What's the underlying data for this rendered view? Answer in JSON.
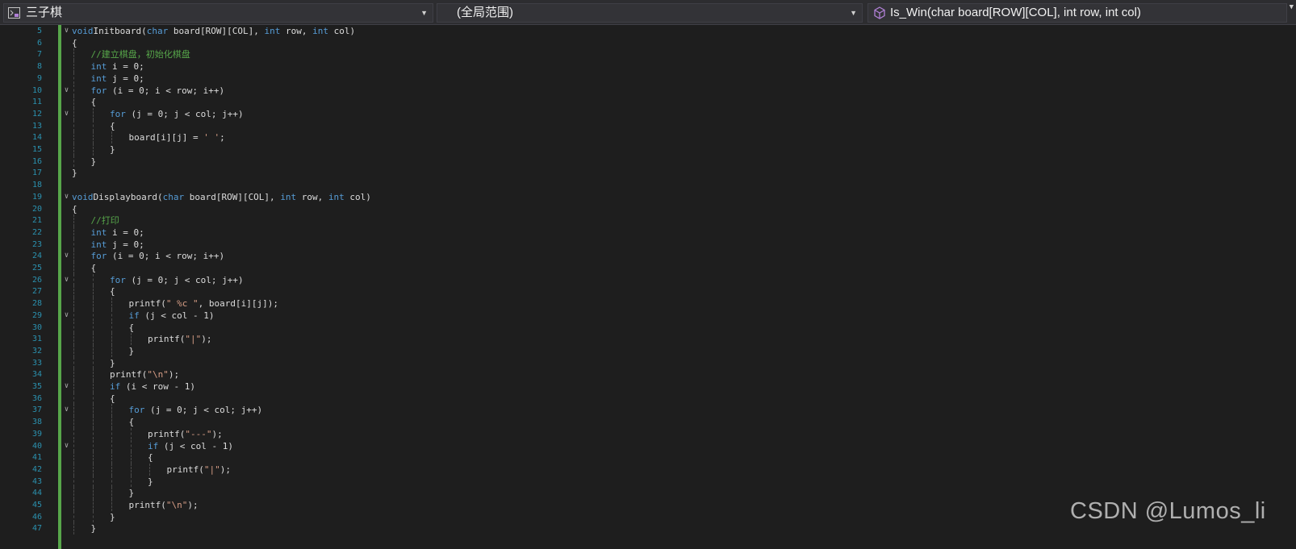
{
  "navbar": {
    "project": "三子棋",
    "scope": "(全局范围)",
    "member": "Is_Win(char board[ROW][COL], int row, int col)"
  },
  "lines": [
    {
      "n": "5",
      "fold": "v",
      "indent": 0,
      "tokens": [
        [
          "kw",
          "void"
        ],
        [
          "",
          "Initboard("
        ],
        [
          "kw",
          "char"
        ],
        [
          "",
          " board[ROW][COL], "
        ],
        [
          "kw",
          "int"
        ],
        [
          "",
          " row, "
        ],
        [
          "kw",
          "int"
        ],
        [
          "",
          " col)"
        ]
      ]
    },
    {
      "n": "6",
      "fold": "",
      "indent": 0,
      "tokens": [
        [
          "",
          "{"
        ]
      ]
    },
    {
      "n": "7",
      "fold": "",
      "indent": 1,
      "tokens": [
        [
          "cm",
          "//建立棋盘，初始化棋盘"
        ]
      ]
    },
    {
      "n": "8",
      "fold": "",
      "indent": 1,
      "tokens": [
        [
          "kw",
          "int"
        ],
        [
          "",
          " i = 0;"
        ]
      ]
    },
    {
      "n": "9",
      "fold": "",
      "indent": 1,
      "tokens": [
        [
          "kw",
          "int"
        ],
        [
          "",
          " j = 0;"
        ]
      ]
    },
    {
      "n": "10",
      "fold": "v",
      "indent": 1,
      "tokens": [
        [
          "kw",
          "for"
        ],
        [
          "",
          " (i = 0; i < row; i++)"
        ]
      ]
    },
    {
      "n": "11",
      "fold": "",
      "indent": 1,
      "tokens": [
        [
          "",
          "{"
        ]
      ]
    },
    {
      "n": "12",
      "fold": "v",
      "indent": 2,
      "tokens": [
        [
          "kw",
          "for"
        ],
        [
          "",
          " (j = 0; j < col; j++)"
        ]
      ]
    },
    {
      "n": "13",
      "fold": "",
      "indent": 2,
      "tokens": [
        [
          "",
          "{"
        ]
      ]
    },
    {
      "n": "14",
      "fold": "",
      "indent": 3,
      "tokens": [
        [
          "",
          "board[i][j] = "
        ],
        [
          "st",
          "' '"
        ],
        [
          "",
          ";"
        ]
      ]
    },
    {
      "n": "15",
      "fold": "",
      "indent": 2,
      "tokens": [
        [
          "",
          "}"
        ]
      ]
    },
    {
      "n": "16",
      "fold": "",
      "indent": 1,
      "tokens": [
        [
          "",
          "}"
        ]
      ]
    },
    {
      "n": "17",
      "fold": "",
      "indent": 0,
      "tokens": [
        [
          "",
          "}"
        ]
      ]
    },
    {
      "n": "18",
      "fold": "",
      "indent": 0,
      "tokens": []
    },
    {
      "n": "19",
      "fold": "v",
      "indent": 0,
      "tokens": [
        [
          "kw",
          "void"
        ],
        [
          "",
          "Displayboard("
        ],
        [
          "kw",
          "char"
        ],
        [
          "",
          " board[ROW][COL], "
        ],
        [
          "kw",
          "int"
        ],
        [
          "",
          " row, "
        ],
        [
          "kw",
          "int"
        ],
        [
          "",
          " col)"
        ]
      ]
    },
    {
      "n": "20",
      "fold": "",
      "indent": 0,
      "tokens": [
        [
          "",
          "{"
        ]
      ]
    },
    {
      "n": "21",
      "fold": "",
      "indent": 1,
      "tokens": [
        [
          "cm",
          "//打印"
        ]
      ]
    },
    {
      "n": "22",
      "fold": "",
      "indent": 1,
      "tokens": [
        [
          "kw",
          "int"
        ],
        [
          "",
          " i = 0;"
        ]
      ]
    },
    {
      "n": "23",
      "fold": "",
      "indent": 1,
      "tokens": [
        [
          "kw",
          "int"
        ],
        [
          "",
          " j = 0;"
        ]
      ]
    },
    {
      "n": "24",
      "fold": "v",
      "indent": 1,
      "tokens": [
        [
          "kw",
          "for"
        ],
        [
          "",
          " (i = 0; i < row; i++)"
        ]
      ]
    },
    {
      "n": "25",
      "fold": "",
      "indent": 1,
      "tokens": [
        [
          "",
          "{"
        ]
      ]
    },
    {
      "n": "26",
      "fold": "v",
      "indent": 2,
      "tokens": [
        [
          "kw",
          "for"
        ],
        [
          "",
          " (j = 0; j < col; j++)"
        ]
      ]
    },
    {
      "n": "27",
      "fold": "",
      "indent": 2,
      "tokens": [
        [
          "",
          "{"
        ]
      ]
    },
    {
      "n": "28",
      "fold": "",
      "indent": 3,
      "tokens": [
        [
          "",
          "printf("
        ],
        [
          "st",
          "\" %c \""
        ],
        [
          "",
          ", board[i][j]);"
        ]
      ]
    },
    {
      "n": "29",
      "fold": "v",
      "indent": 3,
      "tokens": [
        [
          "kw",
          "if"
        ],
        [
          "",
          " (j < col - 1)"
        ]
      ]
    },
    {
      "n": "30",
      "fold": "",
      "indent": 3,
      "tokens": [
        [
          "",
          "{"
        ]
      ]
    },
    {
      "n": "31",
      "fold": "",
      "indent": 4,
      "tokens": [
        [
          "",
          "printf("
        ],
        [
          "st",
          "\"|\""
        ],
        [
          "",
          ");"
        ]
      ]
    },
    {
      "n": "32",
      "fold": "",
      "indent": 3,
      "tokens": [
        [
          "",
          "}"
        ]
      ]
    },
    {
      "n": "33",
      "fold": "",
      "indent": 2,
      "tokens": [
        [
          "",
          "}"
        ]
      ]
    },
    {
      "n": "34",
      "fold": "",
      "indent": 2,
      "tokens": [
        [
          "",
          "printf("
        ],
        [
          "st",
          "\"\\n\""
        ],
        [
          "",
          ");"
        ]
      ]
    },
    {
      "n": "35",
      "fold": "v",
      "indent": 2,
      "tokens": [
        [
          "kw",
          "if"
        ],
        [
          "",
          " (i < row - 1)"
        ]
      ]
    },
    {
      "n": "36",
      "fold": "",
      "indent": 2,
      "tokens": [
        [
          "",
          "{"
        ]
      ]
    },
    {
      "n": "37",
      "fold": "v",
      "indent": 3,
      "tokens": [
        [
          "kw",
          "for"
        ],
        [
          "",
          " (j = 0; j < col; j++)"
        ]
      ]
    },
    {
      "n": "38",
      "fold": "",
      "indent": 3,
      "tokens": [
        [
          "",
          "{"
        ]
      ]
    },
    {
      "n": "39",
      "fold": "",
      "indent": 4,
      "tokens": [
        [
          "",
          "printf("
        ],
        [
          "st",
          "\"---\""
        ],
        [
          "",
          ");"
        ]
      ]
    },
    {
      "n": "40",
      "fold": "v",
      "indent": 4,
      "tokens": [
        [
          "kw",
          "if"
        ],
        [
          "",
          " (j < col - 1)"
        ]
      ]
    },
    {
      "n": "41",
      "fold": "",
      "indent": 4,
      "tokens": [
        [
          "",
          "{"
        ]
      ]
    },
    {
      "n": "42",
      "fold": "",
      "indent": 5,
      "tokens": [
        [
          "",
          "printf("
        ],
        [
          "st",
          "\"|\""
        ],
        [
          "",
          ");"
        ]
      ]
    },
    {
      "n": "43",
      "fold": "",
      "indent": 4,
      "tokens": [
        [
          "",
          "}"
        ]
      ]
    },
    {
      "n": "44",
      "fold": "",
      "indent": 3,
      "tokens": [
        [
          "",
          "}"
        ]
      ]
    },
    {
      "n": "45",
      "fold": "",
      "indent": 3,
      "tokens": [
        [
          "",
          "printf("
        ],
        [
          "st",
          "\"\\n\""
        ],
        [
          "",
          ");"
        ]
      ]
    },
    {
      "n": "46",
      "fold": "",
      "indent": 2,
      "tokens": [
        [
          "",
          "}"
        ]
      ]
    },
    {
      "n": "47",
      "fold": "",
      "indent": 1,
      "tokens": [
        [
          "",
          "}"
        ]
      ]
    }
  ],
  "watermark": "CSDN @Lumos_li"
}
